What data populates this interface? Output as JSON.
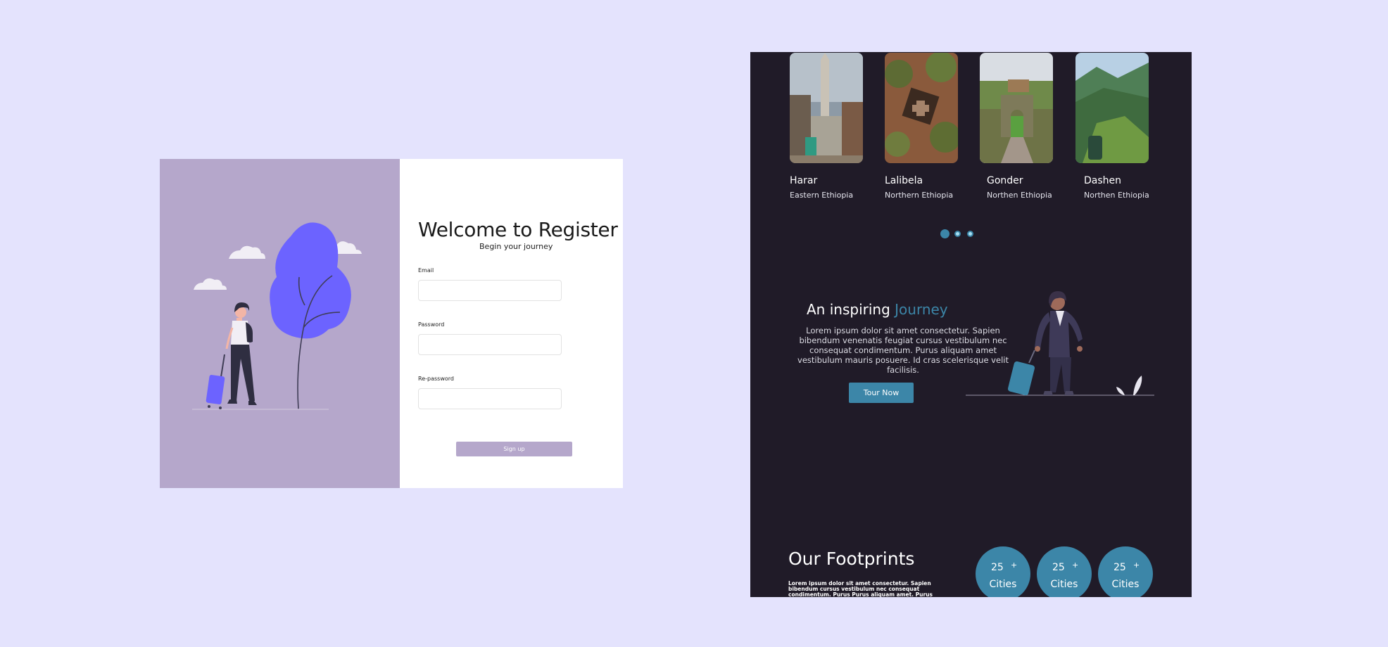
{
  "register": {
    "title": "Welcome to Register",
    "subtitle": "Begin your journey",
    "email_label": "Email",
    "email_value": "",
    "password_label": "Password",
    "password_value": "",
    "repassword_label": "Re-password",
    "repassword_value": "",
    "signup_label": "Sign up"
  },
  "travel": {
    "destinations": [
      {
        "name": "Harar",
        "region": "Eastern Ethiopia"
      },
      {
        "name": "Lalibela",
        "region": "Northern Ethiopia"
      },
      {
        "name": "Gonder",
        "region": "Northen Ethiopia"
      },
      {
        "name": "Dashen",
        "region": "Northen Ethiopia"
      }
    ],
    "carousel_pages": 3,
    "carousel_active": 1,
    "journey": {
      "title_prefix": "An inspiring",
      "title_accent": "Journey",
      "body": "Lorem ipsum dolor sit amet consectetur. Sapien bibendum venenatis feugiat cursus vestibulum nec consequat condimentum. Purus aliquam amet vestibulum mauris posuere. Id cras scelerisque velit facilisis.",
      "button_label": "Tour Now"
    },
    "footprints": {
      "title": "Our Footprints",
      "body": "Lorem ipsum dolor sit amet consectetur. Sapien bibendum cursus vestibulum nec consequat condimentum. Purus Purus aliquam amet. Purus aliquam amet.",
      "stats": [
        {
          "value": "25",
          "suffix": "+",
          "label": "Cities"
        },
        {
          "value": "25",
          "suffix": "+",
          "label": "Cities"
        },
        {
          "value": "25",
          "suffix": "+",
          "label": "Cities"
        }
      ]
    }
  },
  "colors": {
    "canvas": "#e4e3fd",
    "lilac": "#b5a7cb",
    "dark": "#201b28",
    "accent": "#3c86a8",
    "blob": "#6c63ff"
  }
}
